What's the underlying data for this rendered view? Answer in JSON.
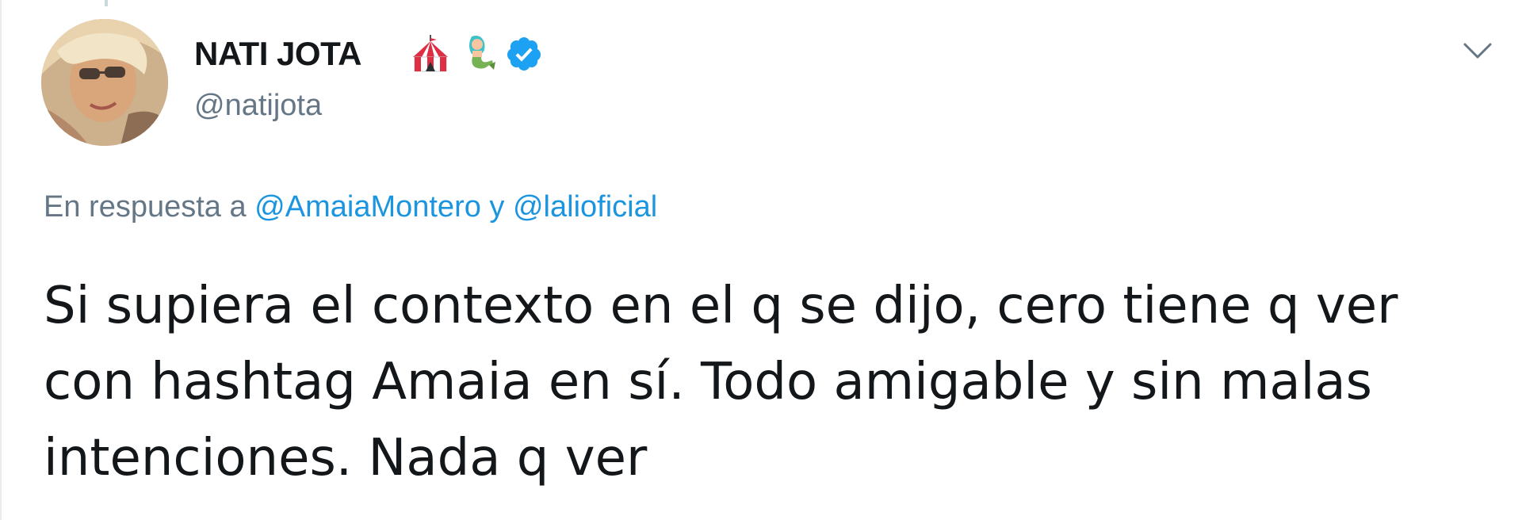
{
  "author": {
    "display_name": "NATI JOTA",
    "handle": "@natijota",
    "verified": true,
    "name_emojis": [
      "circus-tent",
      "mermaid"
    ]
  },
  "reply": {
    "prefix": "En respuesta a",
    "mention_1": "@AmaiaMontero",
    "connector": "y",
    "mention_2": "@lalioficial"
  },
  "tweet": {
    "lines": [
      "Si supiera el contexto en el q se dijo, cero tiene q ver",
      "con hashtag Amaia en sí. Todo amigable y sin malas",
      "intenciones. Nada q ver"
    ]
  },
  "colors": {
    "text": "#14171a",
    "secondary": "#657786",
    "link": "#1b95e0",
    "verified": "#1da1f2"
  },
  "icons": {
    "verified": "verified-badge-icon",
    "caret": "chevron-down-icon"
  }
}
